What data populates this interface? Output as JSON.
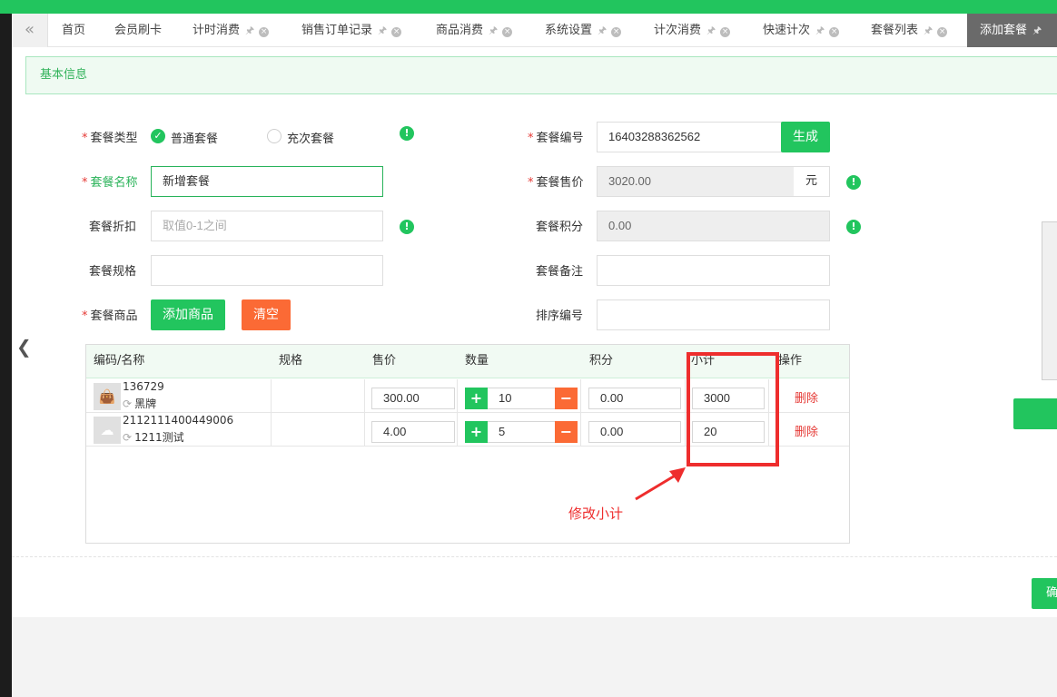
{
  "tabs": [
    {
      "label": "首页",
      "pinned": false,
      "closable": false
    },
    {
      "label": "会员刷卡",
      "pinned": false,
      "closable": false
    },
    {
      "label": "计时消费",
      "pinned": true,
      "closable": true
    },
    {
      "label": "销售订单记录",
      "pinned": true,
      "closable": true
    },
    {
      "label": "商品消费",
      "pinned": true,
      "closable": true
    },
    {
      "label": "系统设置",
      "pinned": true,
      "closable": true
    },
    {
      "label": "计次消费",
      "pinned": true,
      "closable": true
    },
    {
      "label": "快速计次",
      "pinned": true,
      "closable": true
    },
    {
      "label": "套餐列表",
      "pinned": true,
      "closable": true
    },
    {
      "label": "添加套餐",
      "pinned": true,
      "closable": true,
      "active": true
    }
  ],
  "section_title": "基本信息",
  "form": {
    "package_type": {
      "label": "套餐类型",
      "options": [
        "普通套餐",
        "充次套餐"
      ],
      "selected": "普通套餐"
    },
    "package_name": {
      "label": "套餐名称",
      "value": "新增套餐"
    },
    "package_discount": {
      "label": "套餐折扣",
      "placeholder": "取值0-1之间"
    },
    "package_spec": {
      "label": "套餐规格",
      "value": ""
    },
    "package_goods": {
      "label": "套餐商品",
      "add_label": "添加商品",
      "clear_label": "清空"
    },
    "package_code": {
      "label": "套餐编号",
      "value": "16403288362562",
      "generate_label": "生成"
    },
    "package_price": {
      "label": "套餐售价",
      "value": "3020.00",
      "unit": "元"
    },
    "package_points": {
      "label": "套餐积分",
      "value": "0.00"
    },
    "package_remark": {
      "label": "套餐备注",
      "value": ""
    },
    "sort_number": {
      "label": "排序编号",
      "value": ""
    }
  },
  "table": {
    "headers": [
      "编码/名称",
      "规格",
      "售价",
      "数量",
      "积分",
      "小计",
      "操作"
    ],
    "rows": [
      {
        "code": "136729",
        "name": "黑牌",
        "spec": "",
        "price": "300.00",
        "qty": "10",
        "points": "0.00",
        "subtotal": "3000",
        "action": "删除"
      },
      {
        "code": "2112111400449006",
        "name": "1211测试",
        "spec": "",
        "price": "4.00",
        "qty": "5",
        "points": "0.00",
        "subtotal": "20",
        "action": "删除"
      }
    ]
  },
  "annotation": {
    "text": "修改小计",
    "color": "#ee2d2d"
  },
  "confirm_label": "确",
  "colors": {
    "primary": "#22c55e",
    "warning": "#fb6a35",
    "danger": "#e53935"
  },
  "icons": [
    "double-left-chevron-icon",
    "pin-icon",
    "close-circle-icon",
    "check-icon",
    "info-icon",
    "refresh-icon",
    "bag-icon",
    "plus-icon",
    "minus-icon",
    "left-arrow-icon"
  ]
}
